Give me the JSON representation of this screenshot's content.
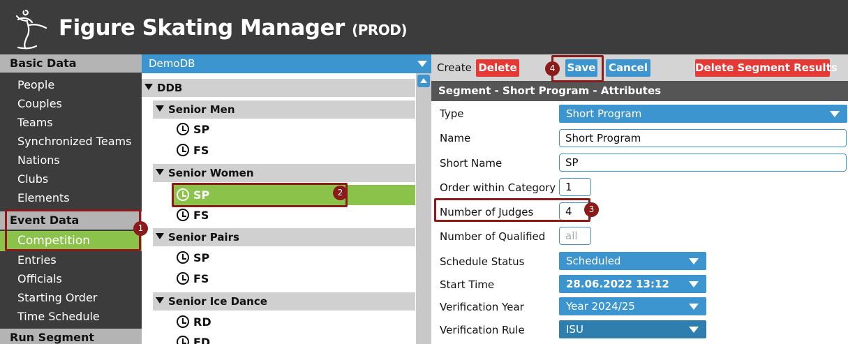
{
  "app": {
    "title": "Figure Skating Manager",
    "env": "(PROD)"
  },
  "sidebar": {
    "sections": [
      {
        "header": "Basic Data",
        "items": [
          "People",
          "Couples",
          "Teams",
          "Synchronized Teams",
          "Nations",
          "Clubs",
          "Elements"
        ]
      },
      {
        "header": "Event Data",
        "items": [
          "Competition",
          "Entries",
          "Officials",
          "Starting Order",
          "Time Schedule"
        ],
        "active_item": "Competition"
      },
      {
        "header": "Run Segment",
        "items": []
      }
    ]
  },
  "tree": {
    "db_selected": "DemoDB",
    "root": "DDB",
    "categories": [
      {
        "name": "Senior Men",
        "segments": [
          "SP",
          "FS"
        ]
      },
      {
        "name": "Senior Women",
        "segments": [
          "SP",
          "FS"
        ],
        "selected_segment": "SP"
      },
      {
        "name": "Senior Pairs",
        "segments": [
          "SP",
          "FS"
        ]
      },
      {
        "name": "Senior Ice Dance",
        "segments": [
          "RD",
          "FD"
        ]
      }
    ]
  },
  "toolbar": {
    "create_label": "Create",
    "delete_label": "Delete",
    "save_label": "Save",
    "cancel_label": "Cancel",
    "delete_results_label": "Delete Segment Results"
  },
  "form": {
    "section_title": "Segment - Short Program - Attributes",
    "fields": {
      "type": {
        "label": "Type",
        "value": "Short Program"
      },
      "name": {
        "label": "Name",
        "value": "Short Program"
      },
      "short_name": {
        "label": "Short Name",
        "value": "SP"
      },
      "order": {
        "label": "Order within Category",
        "value": "1"
      },
      "judges": {
        "label": "Number of Judges",
        "value": "4"
      },
      "qualified": {
        "label": "Number of Qualified",
        "placeholder": "all"
      },
      "schedule_status": {
        "label": "Schedule Status",
        "value": "Scheduled"
      },
      "start_time": {
        "label": "Start Time",
        "value": "28.06.2022 13:12"
      },
      "verification_year": {
        "label": "Verification Year",
        "value": "Year 2024/25"
      },
      "verification_rule": {
        "label": "Verification Rule",
        "value": "ISU"
      }
    }
  },
  "annotations": [
    "1",
    "2",
    "3",
    "4"
  ],
  "colors": {
    "header_bg": "#3c3c3c",
    "accent_blue": "#3c95cf",
    "active_green": "#8bc34a",
    "danger_red": "#e53935",
    "annotation": "#8b1a1a"
  }
}
